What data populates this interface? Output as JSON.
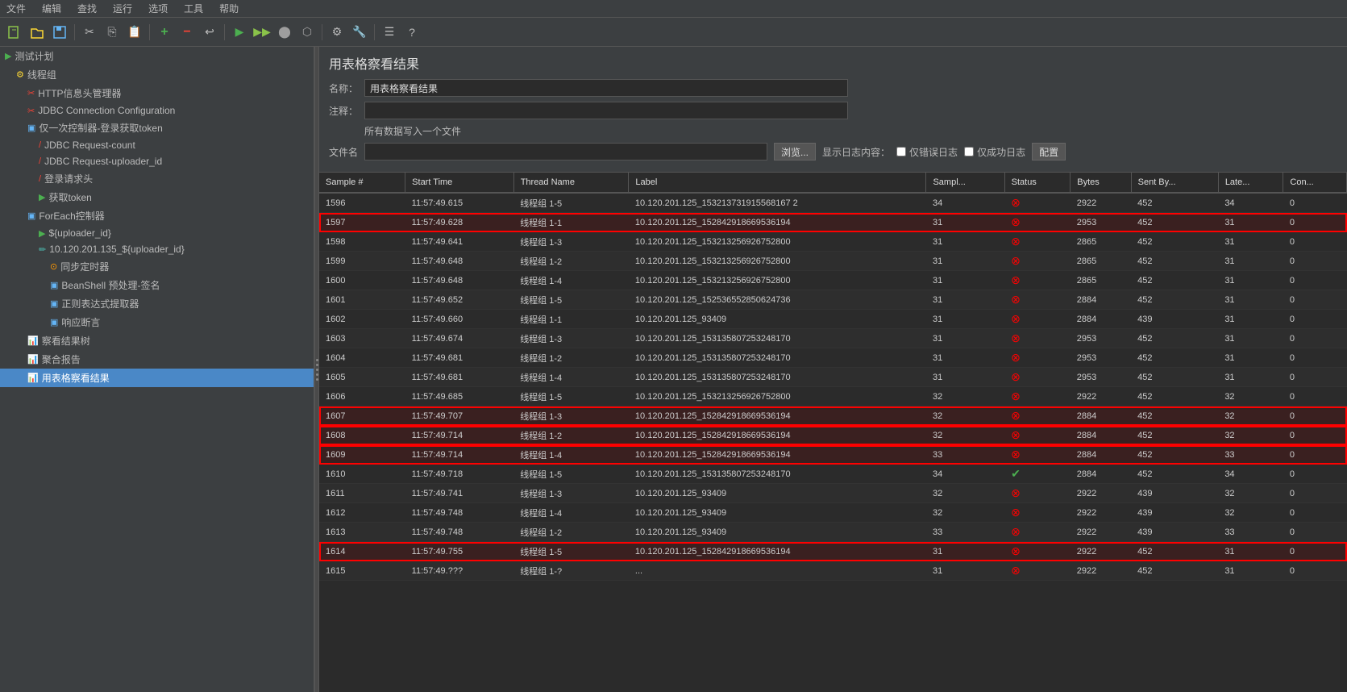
{
  "menuBar": {
    "items": [
      "文件",
      "编辑",
      "查找",
      "运行",
      "选项",
      "工具",
      "帮助"
    ]
  },
  "contentHeader": {
    "title": "用表格察看结果",
    "nameLabel": "名称：",
    "nameValue": "用表格察看结果",
    "commentLabel": "注释：",
    "commentValue": "",
    "writeAllLabel": "所有数据写入一个文件",
    "fileLabel": "文件名",
    "filePlaceholder": "",
    "browseLabel": "浏览...",
    "logLabel": "显示日志内容：",
    "errorLogLabel": "仅错误日志",
    "successLogLabel": "仅成功日志",
    "configLabel": "配置"
  },
  "sidebar": {
    "items": [
      {
        "id": "test-plan",
        "label": "测试计划",
        "indent": 0,
        "icon": "▶",
        "iconType": "plan"
      },
      {
        "id": "thread-group",
        "label": "线程组",
        "indent": 1,
        "icon": "⚙",
        "iconType": "group"
      },
      {
        "id": "http-header",
        "label": "HTTP信息头管理器",
        "indent": 2,
        "icon": "✂",
        "iconType": "http"
      },
      {
        "id": "jdbc-config",
        "label": "JDBC Connection Configuration",
        "indent": 2,
        "icon": "✂",
        "iconType": "jdbc"
      },
      {
        "id": "once-ctrl",
        "label": "仅一次控制器-登录获取token",
        "indent": 2,
        "icon": "□",
        "iconType": "ctrl"
      },
      {
        "id": "jdbc-count",
        "label": "JDBC Request-count",
        "indent": 3,
        "icon": "/",
        "iconType": "req"
      },
      {
        "id": "jdbc-uploader",
        "label": "JDBC Request-uploader_id",
        "indent": 3,
        "icon": "/",
        "iconType": "req"
      },
      {
        "id": "login-head",
        "label": "登录请求头",
        "indent": 3,
        "icon": "/",
        "iconType": "req"
      },
      {
        "id": "get-token",
        "label": "获取token",
        "indent": 3,
        "icon": "▶",
        "iconType": "token"
      },
      {
        "id": "foreach-ctrl",
        "label": "ForEach控制器",
        "indent": 2,
        "icon": "□",
        "iconType": "ctrl"
      },
      {
        "id": "uploader-item",
        "label": "${uploader_id}",
        "indent": 3,
        "icon": "▶",
        "iconType": "item"
      },
      {
        "id": "uploader-req",
        "label": "10.120.201.135_${uploader_id}",
        "indent": 3,
        "icon": "✏",
        "iconType": "req2"
      },
      {
        "id": "sync-timer",
        "label": "同步定时器",
        "indent": 4,
        "icon": "⊙",
        "iconType": "timer"
      },
      {
        "id": "beanshell",
        "label": "BeanShell 预处理-签名",
        "indent": 4,
        "icon": "□",
        "iconType": "bean"
      },
      {
        "id": "regex",
        "label": "正则表达式提取器",
        "indent": 4,
        "icon": "□",
        "iconType": "regex"
      },
      {
        "id": "assert",
        "label": "响应断言",
        "indent": 4,
        "icon": "□",
        "iconType": "assert"
      },
      {
        "id": "view-tree",
        "label": "察看结果树",
        "indent": 2,
        "icon": "📊",
        "iconType": "view"
      },
      {
        "id": "aggregate",
        "label": "聚合报告",
        "indent": 2,
        "icon": "📊",
        "iconType": "agg"
      },
      {
        "id": "table-view",
        "label": "用表格察看结果",
        "indent": 2,
        "icon": "📊",
        "iconType": "table",
        "selected": true
      }
    ]
  },
  "table": {
    "columns": [
      "Sample #",
      "Start Time",
      "Thread Name",
      "Label",
      "Sampl...",
      "Status",
      "Bytes",
      "Sent By...",
      "Late...",
      "Con..."
    ],
    "rows": [
      {
        "id": 1596,
        "startTime": "11:57:49.615",
        "threadName": "线程组 1-5",
        "label": "10.120.201.125_153213731915568167 2",
        "samples": 34,
        "status": "error",
        "bytes": 2922,
        "sentBytes": 452,
        "latency": 34,
        "connect": 0,
        "highlighted": false
      },
      {
        "id": 1597,
        "startTime": "11:57:49.628",
        "threadName": "线程组 1-1",
        "label": "10.120.201.125_152842918669536194",
        "samples": 31,
        "status": "error",
        "bytes": 2953,
        "sentBytes": 452,
        "latency": 31,
        "connect": 0,
        "highlighted": true
      },
      {
        "id": 1598,
        "startTime": "11:57:49.641",
        "threadName": "线程组 1-3",
        "label": "10.120.201.125_153213256926752800",
        "samples": 31,
        "status": "error",
        "bytes": 2865,
        "sentBytes": 452,
        "latency": 31,
        "connect": 0,
        "highlighted": false
      },
      {
        "id": 1599,
        "startTime": "11:57:49.648",
        "threadName": "线程组 1-2",
        "label": "10.120.201.125_153213256926752800",
        "samples": 31,
        "status": "error",
        "bytes": 2865,
        "sentBytes": 452,
        "latency": 31,
        "connect": 0,
        "highlighted": false
      },
      {
        "id": 1600,
        "startTime": "11:57:49.648",
        "threadName": "线程组 1-4",
        "label": "10.120.201.125_153213256926752800",
        "samples": 31,
        "status": "error",
        "bytes": 2865,
        "sentBytes": 452,
        "latency": 31,
        "connect": 0,
        "highlighted": false
      },
      {
        "id": 1601,
        "startTime": "11:57:49.652",
        "threadName": "线程组 1-5",
        "label": "10.120.201.125_152536552850624736",
        "samples": 31,
        "status": "error",
        "bytes": 2884,
        "sentBytes": 452,
        "latency": 31,
        "connect": 0,
        "highlighted": false
      },
      {
        "id": 1602,
        "startTime": "11:57:49.660",
        "threadName": "线程组 1-1",
        "label": "10.120.201.125_93409",
        "samples": 31,
        "status": "error",
        "bytes": 2884,
        "sentBytes": 439,
        "latency": 31,
        "connect": 0,
        "highlighted": false
      },
      {
        "id": 1603,
        "startTime": "11:57:49.674",
        "threadName": "线程组 1-3",
        "label": "10.120.201.125_153135807253248170",
        "samples": 31,
        "status": "error",
        "bytes": 2953,
        "sentBytes": 452,
        "latency": 31,
        "connect": 0,
        "highlighted": false
      },
      {
        "id": 1604,
        "startTime": "11:57:49.681",
        "threadName": "线程组 1-2",
        "label": "10.120.201.125_153135807253248170",
        "samples": 31,
        "status": "error",
        "bytes": 2953,
        "sentBytes": 452,
        "latency": 31,
        "connect": 0,
        "highlighted": false
      },
      {
        "id": 1605,
        "startTime": "11:57:49.681",
        "threadName": "线程组 1-4",
        "label": "10.120.201.125_153135807253248170",
        "samples": 31,
        "status": "error",
        "bytes": 2953,
        "sentBytes": 452,
        "latency": 31,
        "connect": 0,
        "highlighted": false
      },
      {
        "id": 1606,
        "startTime": "11:57:49.685",
        "threadName": "线程组 1-5",
        "label": "10.120.201.125_153213256926752800",
        "samples": 32,
        "status": "error",
        "bytes": 2922,
        "sentBytes": 452,
        "latency": 32,
        "connect": 0,
        "highlighted": false
      },
      {
        "id": 1607,
        "startTime": "11:57:49.707",
        "threadName": "线程组 1-3",
        "label": "10.120.201.125_152842918669536194",
        "samples": 32,
        "status": "error",
        "bytes": 2884,
        "sentBytes": 452,
        "latency": 32,
        "connect": 0,
        "highlighted": true
      },
      {
        "id": 1608,
        "startTime": "11:57:49.714",
        "threadName": "线程组 1-2",
        "label": "10.120.201.125_152842918669536194",
        "samples": 32,
        "status": "error",
        "bytes": 2884,
        "sentBytes": 452,
        "latency": 32,
        "connect": 0,
        "highlighted": true
      },
      {
        "id": 1609,
        "startTime": "11:57:49.714",
        "threadName": "线程组 1-4",
        "label": "10.120.201.125_152842918669536194",
        "samples": 33,
        "status": "error",
        "bytes": 2884,
        "sentBytes": 452,
        "latency": 33,
        "connect": 0,
        "highlighted": true
      },
      {
        "id": 1610,
        "startTime": "11:57:49.718",
        "threadName": "线程组 1-5",
        "label": "10.120.201.125_153135807253248170",
        "samples": 34,
        "status": "ok",
        "bytes": 2884,
        "sentBytes": 452,
        "latency": 34,
        "connect": 0,
        "highlighted": false
      },
      {
        "id": 1611,
        "startTime": "11:57:49.741",
        "threadName": "线程组 1-3",
        "label": "10.120.201.125_93409",
        "samples": 32,
        "status": "error",
        "bytes": 2922,
        "sentBytes": 439,
        "latency": 32,
        "connect": 0,
        "highlighted": false
      },
      {
        "id": 1612,
        "startTime": "11:57:49.748",
        "threadName": "线程组 1-4",
        "label": "10.120.201.125_93409",
        "samples": 32,
        "status": "error",
        "bytes": 2922,
        "sentBytes": 439,
        "latency": 32,
        "connect": 0,
        "highlighted": false
      },
      {
        "id": 1613,
        "startTime": "11:57:49.748",
        "threadName": "线程组 1-2",
        "label": "10.120.201.125_93409",
        "samples": 33,
        "status": "error",
        "bytes": 2922,
        "sentBytes": 439,
        "latency": 33,
        "connect": 0,
        "highlighted": false
      },
      {
        "id": 1614,
        "startTime": "11:57:49.755",
        "threadName": "线程组 1-5",
        "label": "10.120.201.125_152842918669536194",
        "samples": 31,
        "status": "error",
        "bytes": 2922,
        "sentBytes": 452,
        "latency": 31,
        "connect": 0,
        "highlighted": true
      },
      {
        "id": 1615,
        "startTime": "11:57:49.???",
        "threadName": "线程组 1-?",
        "label": "...",
        "samples": 31,
        "status": "error",
        "bytes": 2922,
        "sentBytes": 452,
        "latency": 31,
        "connect": 0,
        "highlighted": false
      }
    ]
  }
}
